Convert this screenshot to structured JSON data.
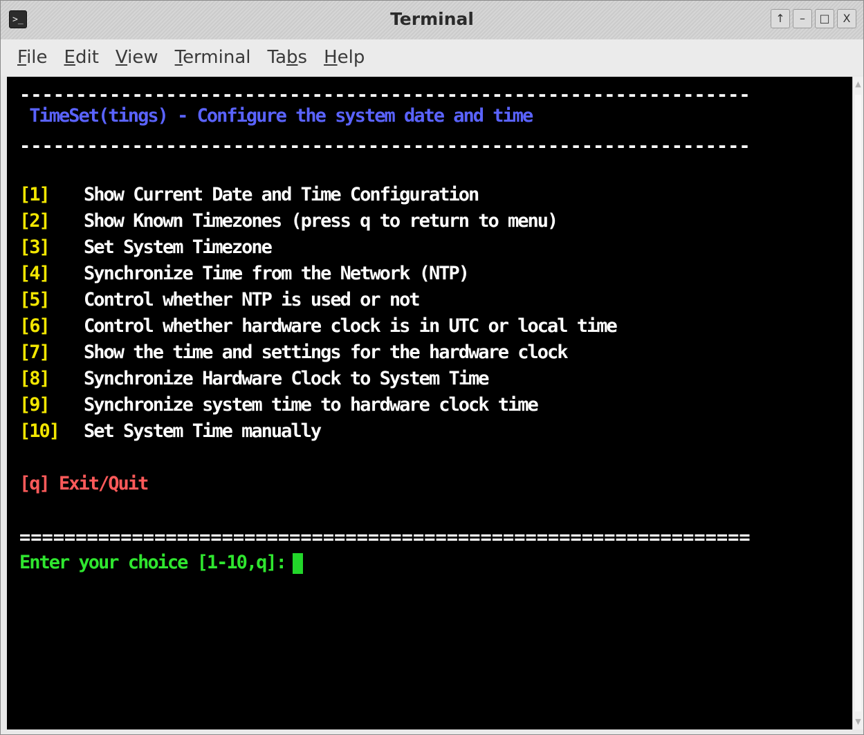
{
  "window": {
    "title": "Terminal",
    "app_icon": "terminal-app-icon",
    "controls": [
      {
        "name": "scroll-up-button",
        "glyph": "↑"
      },
      {
        "name": "minimize-button",
        "glyph": "–"
      },
      {
        "name": "maximize-button",
        "glyph": "□"
      },
      {
        "name": "close-button",
        "glyph": "X"
      }
    ]
  },
  "menubar": {
    "items": [
      {
        "pre": "",
        "accel": "F",
        "post": "ile"
      },
      {
        "pre": "",
        "accel": "E",
        "post": "dit"
      },
      {
        "pre": "",
        "accel": "V",
        "post": "iew"
      },
      {
        "pre": "",
        "accel": "T",
        "post": "erminal"
      },
      {
        "pre": "Ta",
        "accel": "b",
        "post": "s"
      },
      {
        "pre": "",
        "accel": "H",
        "post": "elp"
      }
    ]
  },
  "terminal": {
    "separator_top": "-----------------------------------------------------------------",
    "header": " TimeSet(tings) - Configure the system date and time",
    "separator_mid": "-----------------------------------------------------------------",
    "menu": [
      {
        "num": "[1]",
        "label": "Show Current Date and Time Configuration"
      },
      {
        "num": "[2]",
        "label": "Show Known Timezones (press q to return to menu)"
      },
      {
        "num": "[3]",
        "label": "Set System Timezone"
      },
      {
        "num": "[4]",
        "label": "Synchronize Time from the Network (NTP)"
      },
      {
        "num": "[5]",
        "label": "Control whether NTP is used or not"
      },
      {
        "num": "[6]",
        "label": "Control whether hardware clock is in UTC or local time"
      },
      {
        "num": "[7]",
        "label": "Show the time and settings for the hardware clock"
      },
      {
        "num": "[8]",
        "label": "Synchronize Hardware Clock to System Time"
      },
      {
        "num": "[9]",
        "label": "Synchronize system time to hardware clock time"
      },
      {
        "num": "[10]",
        "label": "Set System Time manually"
      }
    ],
    "quit": "[q] Exit/Quit",
    "separator_bottom": "=================================================================",
    "prompt": "Enter your choice [1-10,q]:"
  },
  "colors": {
    "header": "#5a63ff",
    "menu_number": "#f2e600",
    "menu_label": "#ffffff",
    "quit": "#ff5a5a",
    "prompt": "#2fe62f",
    "background": "#000000"
  }
}
